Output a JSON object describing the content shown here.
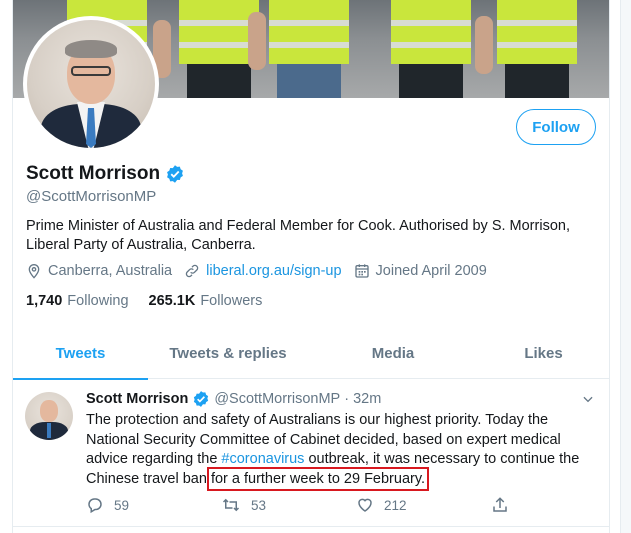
{
  "profile": {
    "name": "Scott Morrison",
    "handle": "@ScottMorrisonMP",
    "follow_label": "Follow",
    "bio": "Prime Minister of Australia and Federal Member for Cook. Authorised by S. Morrison, Liberal Party of Australia, Canberra.",
    "location": "Canberra, Australia",
    "website": "liberal.org.au/sign-up",
    "joined": "Joined April 2009",
    "following_count": "1,740",
    "following_label": "Following",
    "followers_count": "265.1K",
    "followers_label": "Followers"
  },
  "tabs": [
    {
      "label": "Tweets",
      "active": true
    },
    {
      "label": "Tweets & replies",
      "active": false
    },
    {
      "label": "Media",
      "active": false
    },
    {
      "label": "Likes",
      "active": false
    }
  ],
  "tweet": {
    "name": "Scott Morrison",
    "handle": "@ScottMorrisonMP",
    "dot": "·",
    "time": "32m",
    "text_before": "The protection and safety of Australians is our highest priority. Today the National Security Committee of Cabinet decided, based on expert medical advice regarding the ",
    "hashtag": "#coronavirus",
    "text_middle": " outbreak, it was necessary to continue the Chinese travel ban ",
    "text_highlight": "for a further week to 29 February.",
    "replies": "59",
    "retweets": "53",
    "likes": "212"
  },
  "colors": {
    "accent": "#1da1f2",
    "link": "#1b95e0",
    "muted": "#657786",
    "highlight_box": "#d8181f"
  },
  "icons": [
    "location-icon",
    "link-icon",
    "calendar-icon",
    "verified-icon",
    "chevron-down-icon",
    "reply-icon",
    "retweet-icon",
    "like-icon",
    "share-icon"
  ]
}
